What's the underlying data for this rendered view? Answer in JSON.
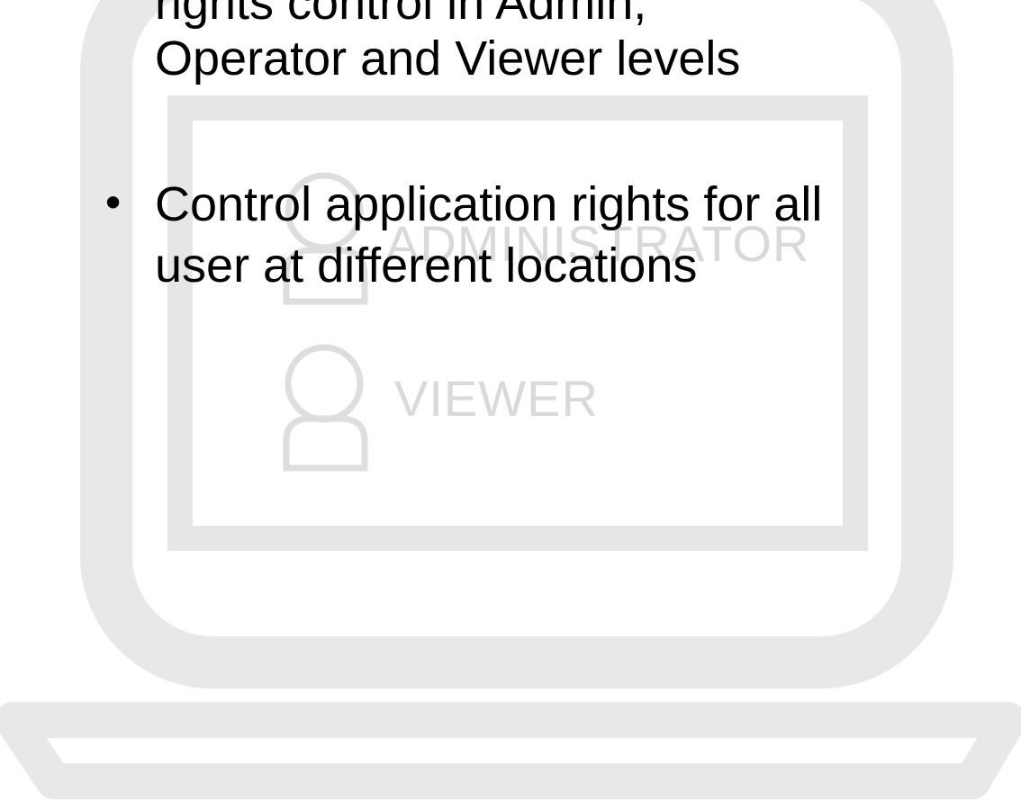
{
  "slide": {
    "bullets": [
      {
        "bullet": "",
        "lines": [
          "rights control in Admin,",
          "Operator and Viewer levels"
        ]
      },
      {
        "bullet": "•",
        "lines": [
          "Control application rights for all",
          "user at different locations"
        ]
      }
    ]
  },
  "illustration": {
    "roles": [
      "ADMINISTRATOR",
      "VIEWER"
    ],
    "icons": [
      "laptop-icon",
      "user-icon",
      "user-icon"
    ],
    "colors": {
      "outline": "#e6e6e6",
      "label": "#d9d9d9",
      "text": "#000000",
      "background": "#ffffff"
    }
  }
}
